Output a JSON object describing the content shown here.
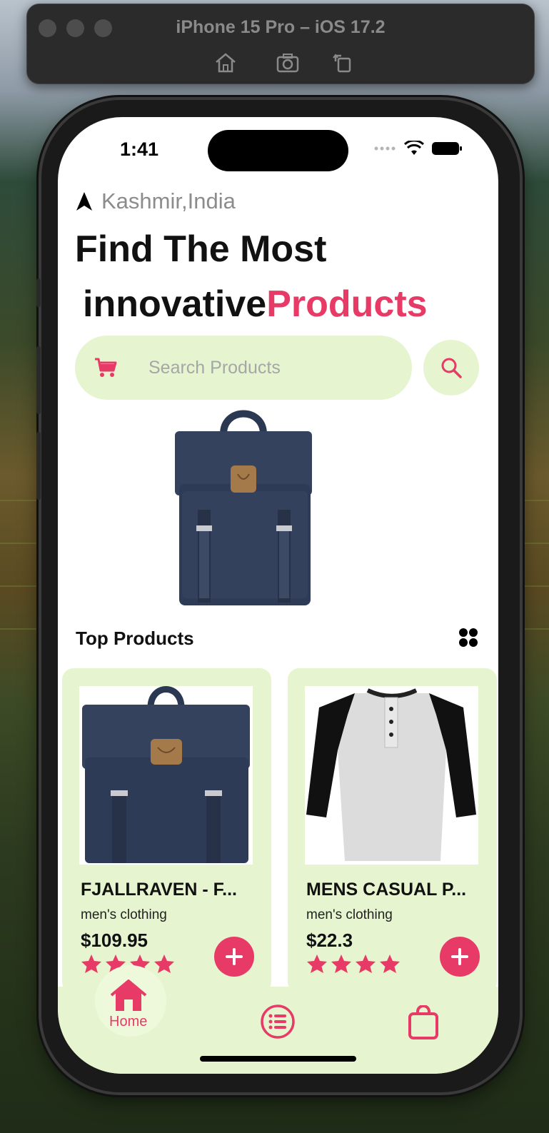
{
  "simulator": {
    "title": "iPhone 15 Pro – iOS 17.2",
    "toolbar": [
      "home-icon",
      "screenshot-icon",
      "rotate-icon"
    ]
  },
  "status_bar": {
    "time": "1:41"
  },
  "header": {
    "location": "Kashmir,India",
    "headline_line1": "Find The Most",
    "headline_line2_plain": "innovative",
    "headline_line2_accent": "Products"
  },
  "search": {
    "placeholder": "Search Products"
  },
  "section": {
    "title": "Top Products"
  },
  "products": [
    {
      "title": "FJALLRAVEN - F...",
      "category": "men's clothing",
      "price": "$109.95",
      "rating": 4
    },
    {
      "title": "MENS CASUAL P...",
      "category": "men's clothing",
      "price": "$22.3",
      "rating": 4
    }
  ],
  "tab_bar": {
    "home_label": "Home"
  },
  "colors": {
    "accent": "#e83a66",
    "mint": "#e6f5cf"
  }
}
